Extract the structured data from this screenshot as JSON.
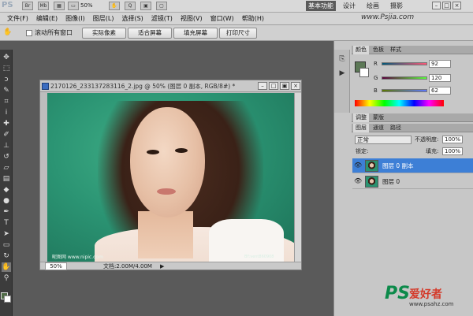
{
  "app": {
    "logo": "PS",
    "zoom": "50%",
    "watermark_url": "www.Psjia.com"
  },
  "workspaces": [
    "基本功能",
    "设计",
    "绘画",
    "摄影"
  ],
  "menu": [
    "文件(F)",
    "编辑(E)",
    "图像(I)",
    "图层(L)",
    "选择(S)",
    "滤镜(T)",
    "视图(V)",
    "窗口(W)",
    "帮助(H)"
  ],
  "options": {
    "scroll_all_label": "滚动所有窗口",
    "buttons": [
      "实际像素",
      "适合屏幕",
      "填充屏幕",
      "打印尺寸"
    ]
  },
  "document": {
    "title": "2170126_233137283116_2.jpg @ 50% (图层 0 副本, RGB/8#) *",
    "zoom": "50%",
    "doc_size": "文档:2.00M/4.00M",
    "status_arrow": "▶",
    "watermark_left": "昵图网 www.nipic.com",
    "watermark_right": "BY:vent860908"
  },
  "color_panel": {
    "tabs": [
      "颜色",
      "色板",
      "样式"
    ],
    "sliders": [
      {
        "label": "R",
        "value": "92",
        "colors": [
          "#005878",
          "#ff5878"
        ]
      },
      {
        "label": "G",
        "value": "120",
        "colors": [
          "#5c003e",
          "#5cff3e"
        ]
      },
      {
        "label": "B",
        "value": "62",
        "colors": [
          "#5c7800",
          "#5c78ff"
        ]
      }
    ]
  },
  "adjust_tabs": [
    "调整",
    "蒙版"
  ],
  "layers_panel": {
    "tabs": [
      "图层",
      "通道",
      "路径"
    ],
    "blend_mode": "正常",
    "opacity_label": "不透明度:",
    "opacity": "100%",
    "lock_label": "锁定:",
    "fill_label": "填充:",
    "fill": "100%",
    "layers": [
      {
        "name": "图层 0 副本",
        "selected": true
      },
      {
        "name": "图层 0",
        "selected": false
      }
    ]
  },
  "brand": {
    "ps": "PS",
    "cn": "爱好者",
    "url": "www.psahz.com"
  }
}
